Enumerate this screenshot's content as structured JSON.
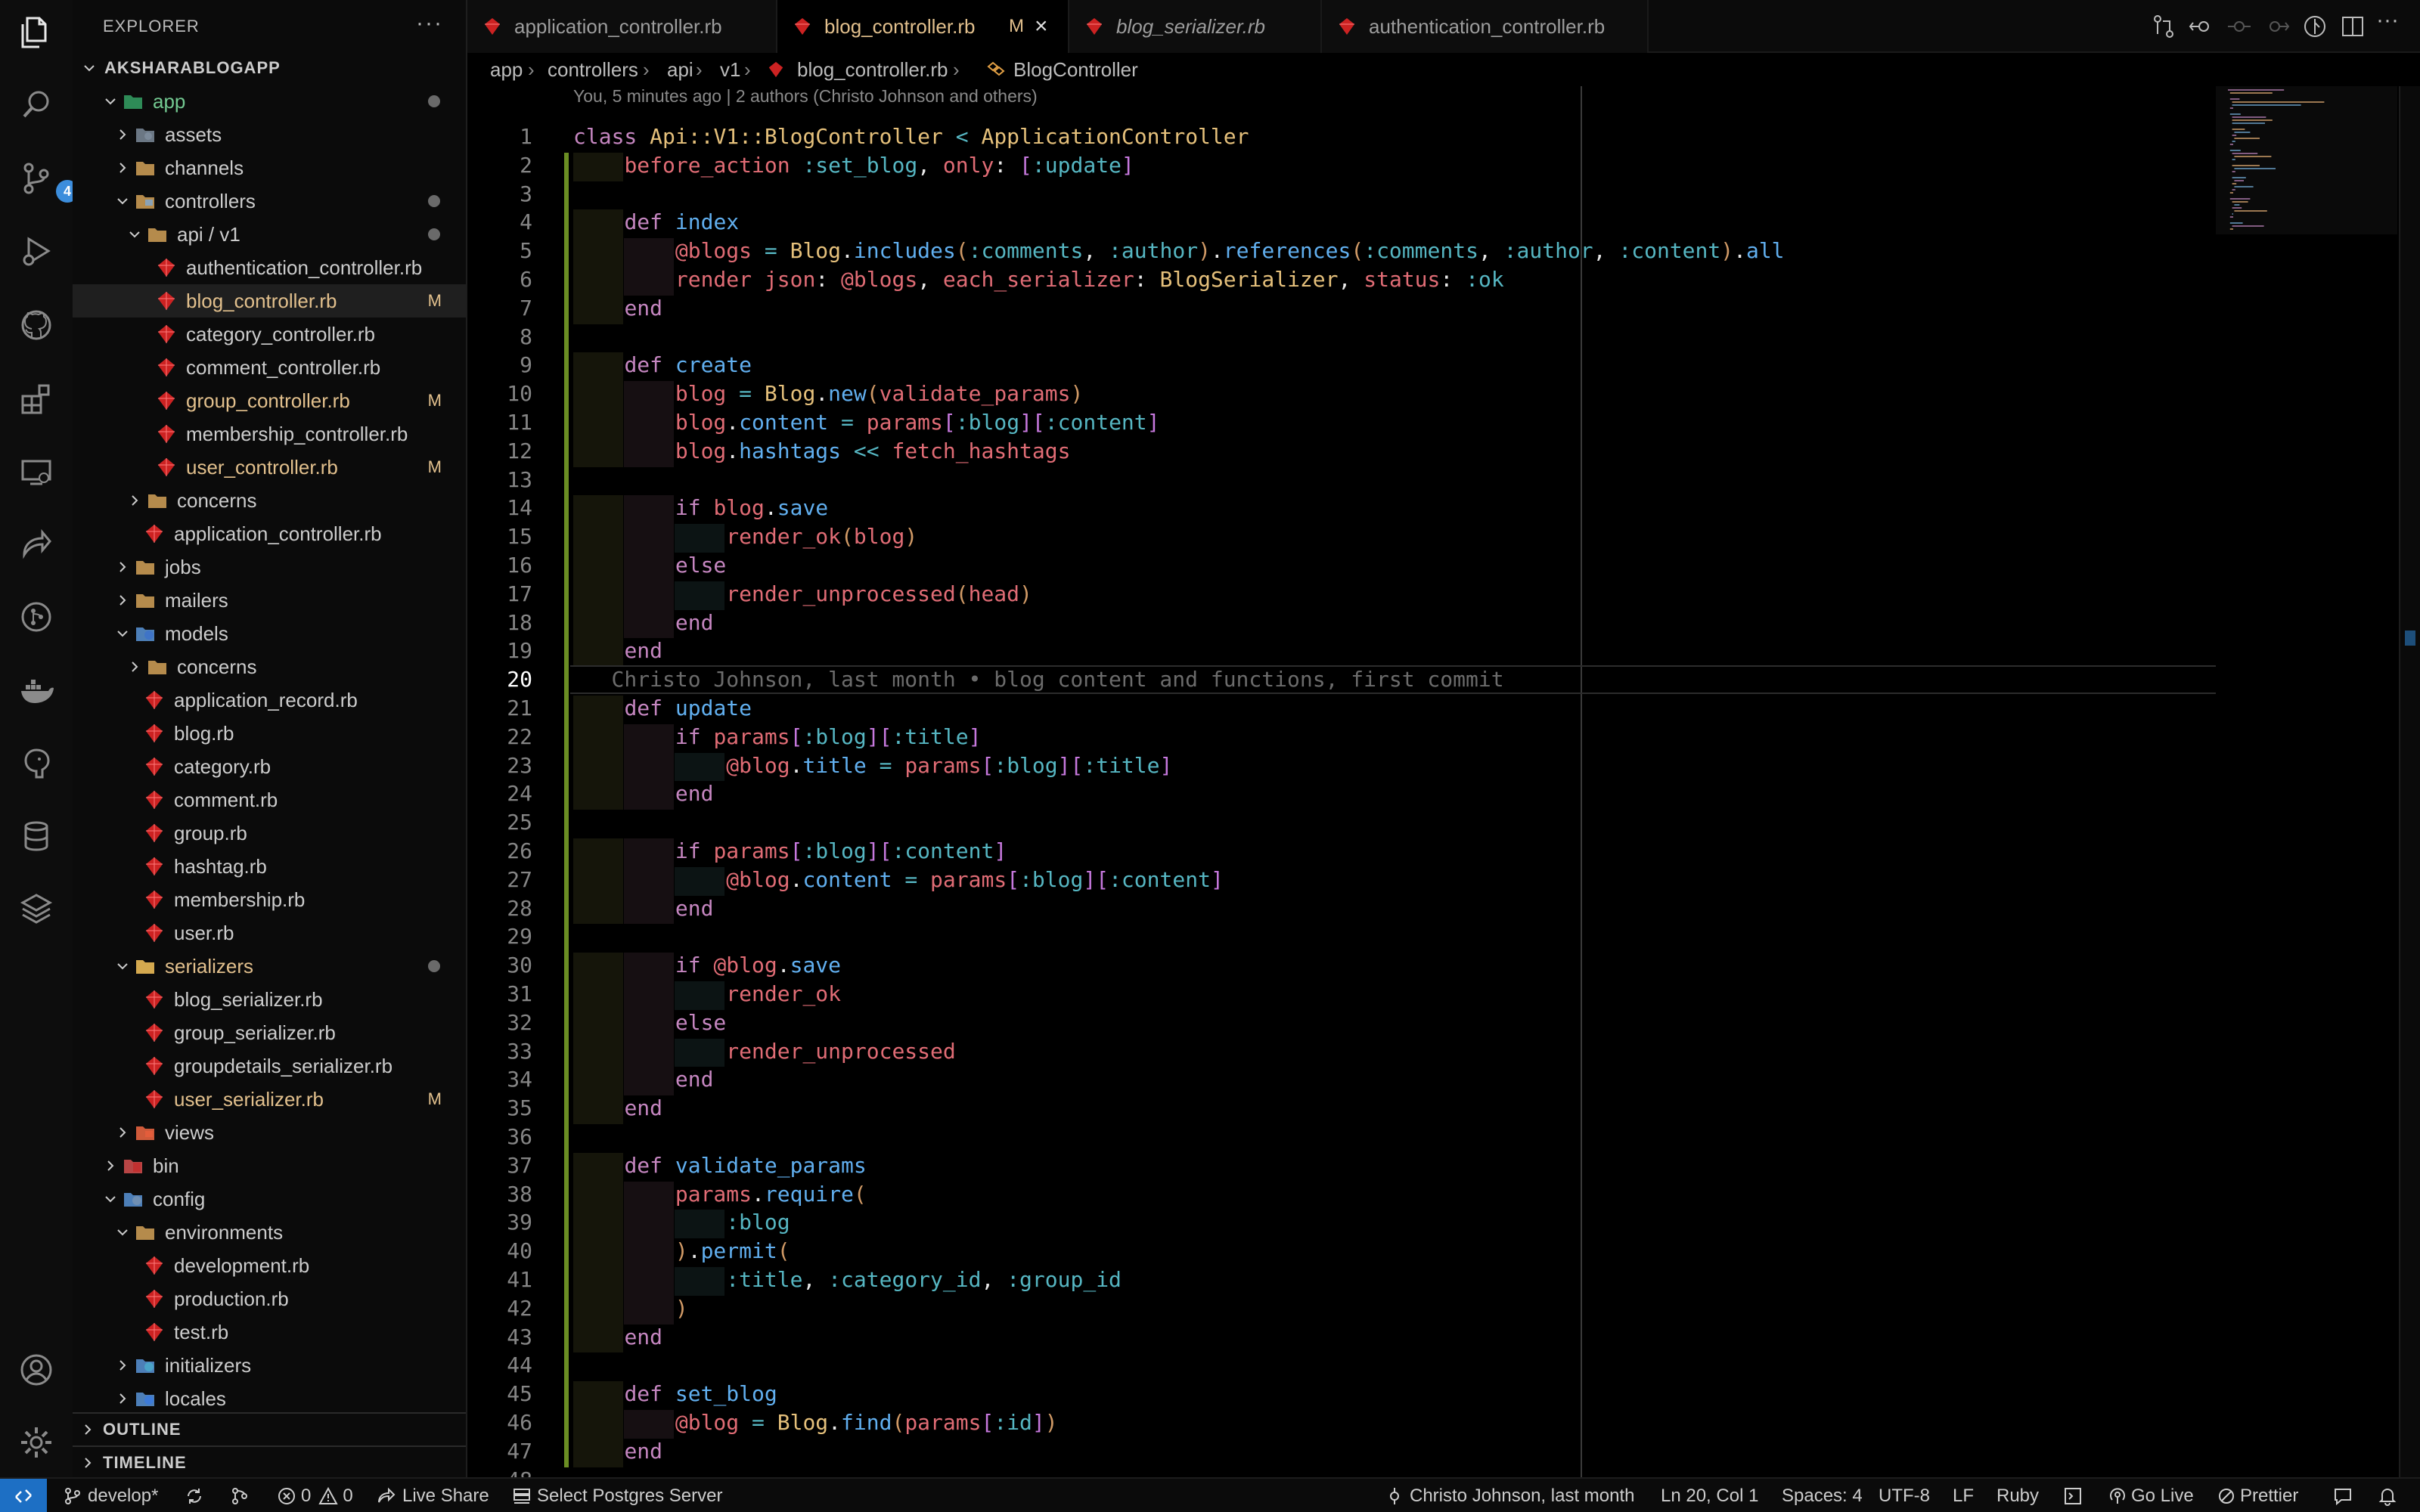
{
  "sidebar": {
    "title": "EXPLORER",
    "more": "···",
    "tree": [
      {
        "label": "AKSHARABLOGAPP",
        "type": "root",
        "depth": 0,
        "chevron": "down"
      },
      {
        "label": "app",
        "type": "folder",
        "depth": 1,
        "chevron": "down",
        "icon": "app-folder-icon",
        "dot": true,
        "green": true
      },
      {
        "label": "assets",
        "type": "folder",
        "depth": 2,
        "chevron": "right",
        "icon": "assets-folder-icon"
      },
      {
        "label": "channels",
        "type": "folder",
        "depth": 2,
        "chevron": "right",
        "icon": "folder-icon"
      },
      {
        "label": "controllers",
        "type": "folder",
        "depth": 2,
        "chevron": "down",
        "icon": "controllers-folder-icon",
        "dot": true
      },
      {
        "label": "api / v1",
        "type": "folder",
        "depth": 3,
        "chevron": "down",
        "icon": "folder-open-icon",
        "dot": true
      },
      {
        "label": "authentication_controller.rb",
        "type": "file",
        "depth": 4
      },
      {
        "label": "blog_controller.rb",
        "type": "file",
        "depth": 4,
        "mod": "M",
        "selected": true
      },
      {
        "label": "category_controller.rb",
        "type": "file",
        "depth": 4
      },
      {
        "label": "comment_controller.rb",
        "type": "file",
        "depth": 4
      },
      {
        "label": "group_controller.rb",
        "type": "file",
        "depth": 4,
        "mod": "M"
      },
      {
        "label": "membership_controller.rb",
        "type": "file",
        "depth": 4
      },
      {
        "label": "user_controller.rb",
        "type": "file",
        "depth": 4,
        "mod": "M"
      },
      {
        "label": "concerns",
        "type": "folder",
        "depth": 3,
        "chevron": "right",
        "icon": "folder-icon"
      },
      {
        "label": "application_controller.rb",
        "type": "file",
        "depth": 3
      },
      {
        "label": "jobs",
        "type": "folder",
        "depth": 2,
        "chevron": "right",
        "icon": "folder-icon"
      },
      {
        "label": "mailers",
        "type": "folder",
        "depth": 2,
        "chevron": "right",
        "icon": "folder-icon"
      },
      {
        "label": "models",
        "type": "folder",
        "depth": 2,
        "chevron": "down",
        "icon": "models-folder-icon"
      },
      {
        "label": "concerns",
        "type": "folder",
        "depth": 3,
        "chevron": "right",
        "icon": "folder-icon"
      },
      {
        "label": "application_record.rb",
        "type": "file",
        "depth": 3
      },
      {
        "label": "blog.rb",
        "type": "file",
        "depth": 3
      },
      {
        "label": "category.rb",
        "type": "file",
        "depth": 3
      },
      {
        "label": "comment.rb",
        "type": "file",
        "depth": 3
      },
      {
        "label": "group.rb",
        "type": "file",
        "depth": 3
      },
      {
        "label": "hashtag.rb",
        "type": "file",
        "depth": 3
      },
      {
        "label": "membership.rb",
        "type": "file",
        "depth": 3
      },
      {
        "label": "user.rb",
        "type": "file",
        "depth": 3
      },
      {
        "label": "serializers",
        "type": "folder",
        "depth": 2,
        "chevron": "down",
        "icon": "folder-open-icon",
        "dot": true,
        "yellow": true
      },
      {
        "label": "blog_serializer.rb",
        "type": "file",
        "depth": 3
      },
      {
        "label": "group_serializer.rb",
        "type": "file",
        "depth": 3
      },
      {
        "label": "groupdetails_serializer.rb",
        "type": "file",
        "depth": 3
      },
      {
        "label": "user_serializer.rb",
        "type": "file",
        "depth": 3,
        "mod": "M"
      },
      {
        "label": "views",
        "type": "folder",
        "depth": 2,
        "chevron": "right",
        "icon": "views-folder-icon"
      },
      {
        "label": "bin",
        "type": "folder",
        "depth": 1,
        "chevron": "right",
        "icon": "bin-folder-icon"
      },
      {
        "label": "config",
        "type": "folder",
        "depth": 1,
        "chevron": "down",
        "icon": "config-folder-icon"
      },
      {
        "label": "environments",
        "type": "folder",
        "depth": 2,
        "chevron": "down",
        "icon": "folder-open-icon"
      },
      {
        "label": "development.rb",
        "type": "file",
        "depth": 3
      },
      {
        "label": "production.rb",
        "type": "file",
        "depth": 3
      },
      {
        "label": "test.rb",
        "type": "file",
        "depth": 3
      },
      {
        "label": "initializers",
        "type": "folder",
        "depth": 2,
        "chevron": "right",
        "icon": "initializers-folder-icon"
      },
      {
        "label": "locales",
        "type": "folder",
        "depth": 2,
        "chevron": "right",
        "icon": "locales-folder-icon"
      }
    ],
    "outline": "OUTLINE",
    "timeline": "TIMELINE"
  },
  "activity": {
    "scm_badge": "4",
    "icons": [
      "explorer-icon",
      "search-icon",
      "source-control-icon",
      "run-debug-icon",
      "github-icon",
      "extensions-icon",
      "remote-explorer-icon",
      "live-share-icon",
      "git-graph-icon",
      "docker-icon",
      "postgres-icon",
      "database-icon",
      "layers-icon"
    ]
  },
  "tabs": [
    {
      "label": "application_controller.rb",
      "active": false,
      "italic": false
    },
    {
      "label": "blog_controller.rb",
      "active": true,
      "italic": false,
      "mod": "M"
    },
    {
      "label": "blog_serializer.rb",
      "active": false,
      "italic": true
    },
    {
      "label": "authentication_controller.rb",
      "active": false,
      "italic": false
    }
  ],
  "breadcrumb": {
    "parts": [
      "app",
      "controllers",
      "api",
      "v1",
      "blog_controller.rb",
      "BlogController"
    ]
  },
  "editor": {
    "blame_top": "You, 5 minutes ago | 2 authors (Christo Johnson and others)",
    "current_line": 20,
    "inline_blame": "Christo Johnson, last month • blog content and functions, first commit",
    "lines": [
      "class Api::V1::BlogController < ApplicationController",
      "  before_action :set_blog, only: [:update]",
      "",
      "  def index",
      "    @blogs = Blog.includes(:comments, :author).references(:comments, :author, :content).all",
      "    render json: @blogs, each_serializer: BlogSerializer, status: :ok",
      "  end",
      "",
      "  def create",
      "    blog = Blog.new(validate_params)",
      "    blog.content = params[:blog][:content]",
      "    blog.hashtags << fetch_hashtags",
      "",
      "    if blog.save",
      "      render_ok(blog)",
      "    else",
      "      render_unprocessed(head)",
      "    end",
      "  end",
      "",
      "  def update",
      "    if params[:blog][:title]",
      "      @blog.title = params[:blog][:title]",
      "    end",
      "",
      "    if params[:blog][:content]",
      "      @blog.content = params[:blog][:content]",
      "    end",
      "",
      "    if @blog.save",
      "      render_ok",
      "    else",
      "      render_unprocessed",
      "    end",
      "  end",
      "",
      "  def validate_params",
      "    params.require(",
      "      :blog",
      "    ).permit(",
      "      :title, :category_id, :group_id",
      "    )",
      "  end",
      "",
      "  def set_blog",
      "    @blog = Blog.find(params[:id])",
      "  end",
      ""
    ]
  },
  "status": {
    "branch": "develop*",
    "errors": "0",
    "warnings": "0",
    "live_share": "Live Share",
    "postgres": "Select Postgres Server",
    "blame": "Christo Johnson, last month",
    "position": "Ln 20, Col 1",
    "spaces": "Spaces: 4",
    "encoding": "UTF-8",
    "eol": "LF",
    "language": "Ruby",
    "go_live": "Go Live",
    "prettier": "Prettier"
  },
  "colors": {
    "accent": "#1d6fc4",
    "modified": "#e2c08d",
    "ruby_icon": "#cc2222",
    "git_added": "#6b8e23"
  }
}
